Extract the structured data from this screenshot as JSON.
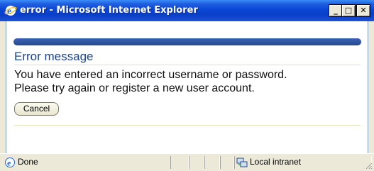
{
  "window": {
    "title": "error - Microsoft Internet Explorer",
    "min_label": "_",
    "max_label": "□",
    "close_label": "✕"
  },
  "page": {
    "heading": "Error message",
    "message_line1": "You have entered an incorrect username or password.",
    "message_line2": "Please try again or register a new user account.",
    "cancel_label": "Cancel"
  },
  "status": {
    "left_text": "Done",
    "zone_text": "Local intranet"
  },
  "colors": {
    "title_bar": "#0a46d6",
    "heading": "#1c4489",
    "top_bar": "#2b4f98"
  }
}
